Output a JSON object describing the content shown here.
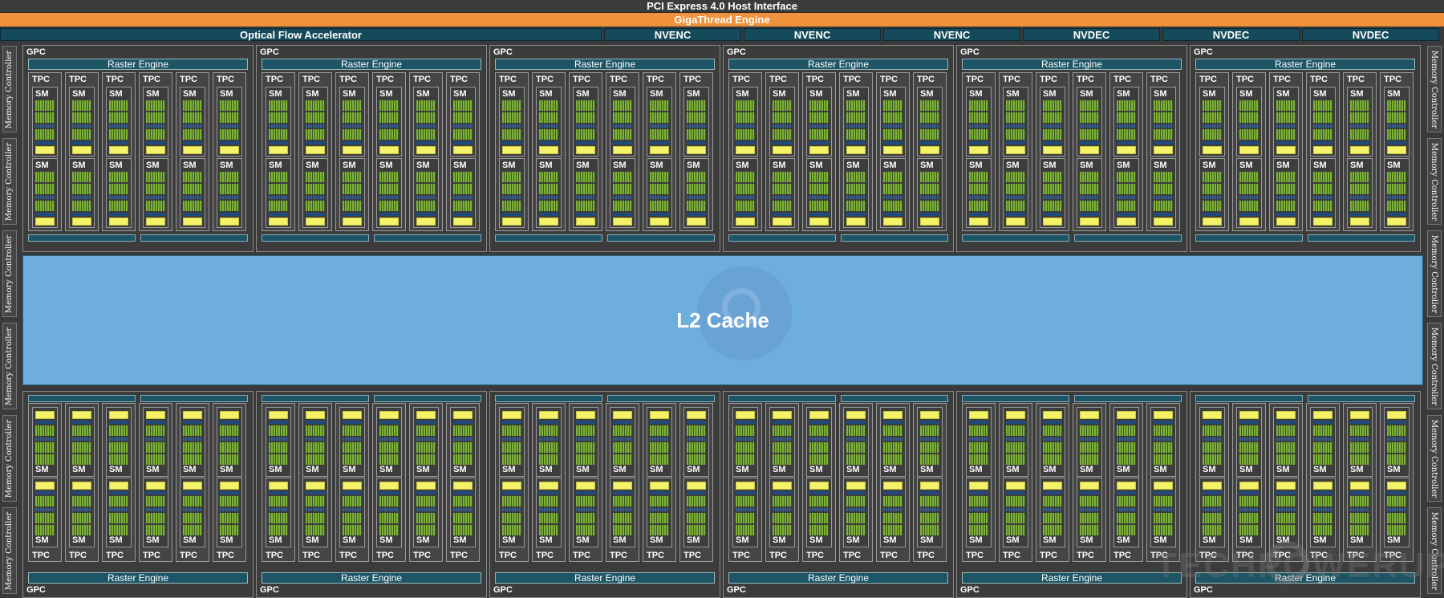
{
  "header": {
    "pcie": "PCI Express 4.0 Host Interface",
    "gigathread": "GigaThread Engine"
  },
  "engines": [
    "Optical Flow Accelerator",
    "NVENC",
    "NVENC",
    "NVENC",
    "NVDEC",
    "NVDEC",
    "NVDEC"
  ],
  "l2_cache": "L2 Cache",
  "memory_controller_label": "Memory Controller",
  "gpc_label": "GPC",
  "raster_label": "Raster Engine",
  "tpc_label": "TPC",
  "sm_label": "SM",
  "watermark": "TECHPOWERUP",
  "colors": {
    "pcie_bar": "#3c3c3c",
    "gigathread_bar": "#f0923b",
    "engine_bar": "#154a5a",
    "l2_cache": "#6daedc",
    "cuda_core": "#7fb33a",
    "rt_core": "#f4f268",
    "raster_engine": "#1d5566"
  }
}
